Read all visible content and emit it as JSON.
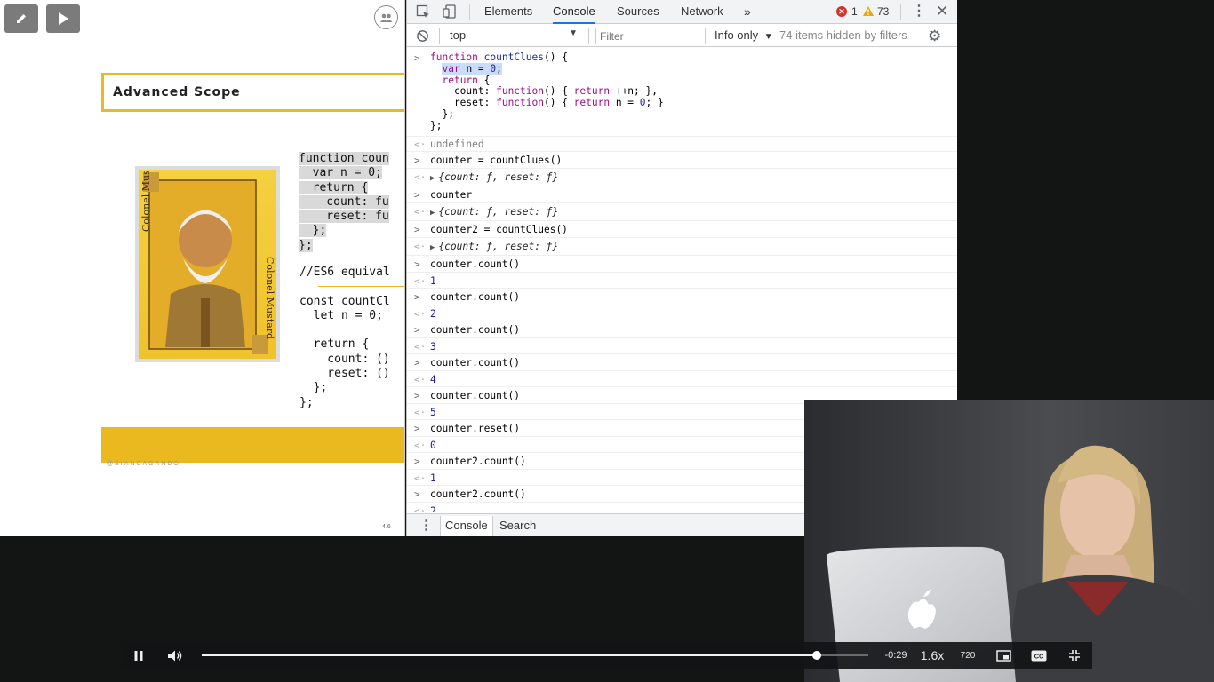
{
  "slide": {
    "title": "Advanced Scope",
    "code_top": [
      "function coun",
      "  var n = 0;",
      "  return {",
      "    count: fu",
      "    reset: fu",
      "  };",
      "};"
    ],
    "code_bottom": [
      "//ES6 equival",
      "",
      "const countCl",
      "  let n = 0;",
      "",
      "  return {",
      "    count: ()",
      "    reset: ()",
      "  };",
      "};"
    ],
    "card_text_left": "Colonel Mustard",
    "card_text_right": "Colonel Mustard",
    "handle": "@BIANCAGANDO",
    "page_number": "4.6"
  },
  "devtools": {
    "tabs": [
      "Elements",
      "Console",
      "Sources",
      "Network"
    ],
    "more_tabs": "»",
    "active_tab": "Console",
    "error_count": "1",
    "warning_count": "73",
    "context": "top",
    "filter_placeholder": "Filter",
    "level": "Info only",
    "hidden_text": "74 items hidden by filters",
    "entries": [
      {
        "in": "counter = countClues()",
        "out": "{count: ƒ, reset: ƒ}",
        "type": "obj"
      },
      {
        "in": "counter",
        "out": "{count: ƒ, reset: ƒ}",
        "type": "obj"
      },
      {
        "in": "counter2 = countClues()",
        "out": "{count: ƒ, reset: ƒ}",
        "type": "obj"
      },
      {
        "in": "counter.count()",
        "out": "1",
        "type": "num"
      },
      {
        "in": "counter.count()",
        "out": "2",
        "type": "num"
      },
      {
        "in": "counter.count()",
        "out": "3",
        "type": "num"
      },
      {
        "in": "counter.count()",
        "out": "4",
        "type": "num"
      },
      {
        "in": "counter.count()",
        "out": "5",
        "type": "num"
      },
      {
        "in": "counter.reset()",
        "out": "0",
        "type": "num"
      },
      {
        "in": "counter2.count()",
        "out": "1",
        "type": "num"
      },
      {
        "in": "counter2.count()",
        "out": "2",
        "type": "num"
      }
    ],
    "first_result": "undefined",
    "drawer_tabs": [
      "Console",
      "Search"
    ]
  },
  "player": {
    "time_remaining": "-0:29",
    "speed": "1.6x",
    "quality": "720",
    "progress": 0.923
  },
  "colors": {
    "accent_yellow": "#e9b91f",
    "devtools_blue": "#1a73e8",
    "error_red": "#d93025",
    "warning_yellow": "#f2a600"
  }
}
